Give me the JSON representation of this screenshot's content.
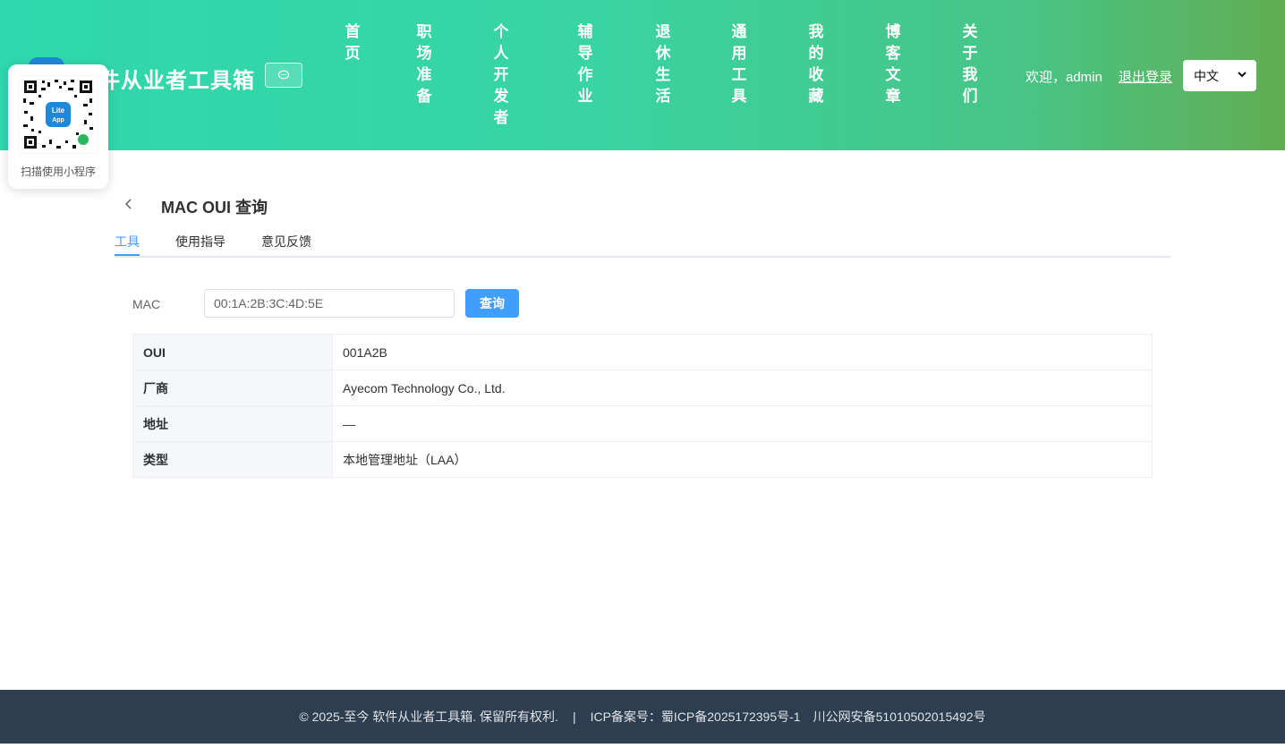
{
  "header": {
    "title": "件从业者工具箱",
    "nav": [
      "首页",
      "职场准备",
      "个人开发者",
      "辅导作业",
      "退休生活",
      "通用工具",
      "我的收藏",
      "博客文章",
      "关于我们"
    ],
    "welcome": "欢迎，admin",
    "logout": "退出登录",
    "language": "中文"
  },
  "qr": {
    "badge_top": "Lite",
    "badge_bottom": "App",
    "label": "扫描使用小程序"
  },
  "page": {
    "title": "MAC OUI 查询",
    "tabs": [
      "工具",
      "使用指导",
      "意见反馈"
    ],
    "active_tab": 0
  },
  "form": {
    "mac_label": "MAC",
    "mac_value": "00:1A:2B:3C:4D:5E",
    "submit": "查询"
  },
  "result": [
    {
      "key": "OUI",
      "value": "001A2B"
    },
    {
      "key": "厂商",
      "value": "Ayecom Technology Co., Ltd."
    },
    {
      "key": "地址",
      "value": "—"
    },
    {
      "key": "类型",
      "value": "本地管理地址（LAA）"
    }
  ],
  "footer": {
    "copyright": "© 2025-至今 软件从业者工具箱. 保留所有权利.",
    "separator": "|",
    "icp": "ICP备案号：蜀ICP备2025172395号-1",
    "police": "川公网安备51010502015492号"
  },
  "colors": {
    "accent": "#409eff",
    "footer_bg": "#2c3e50",
    "header_start": "#2fd8ad",
    "header_end": "#62ad52"
  }
}
